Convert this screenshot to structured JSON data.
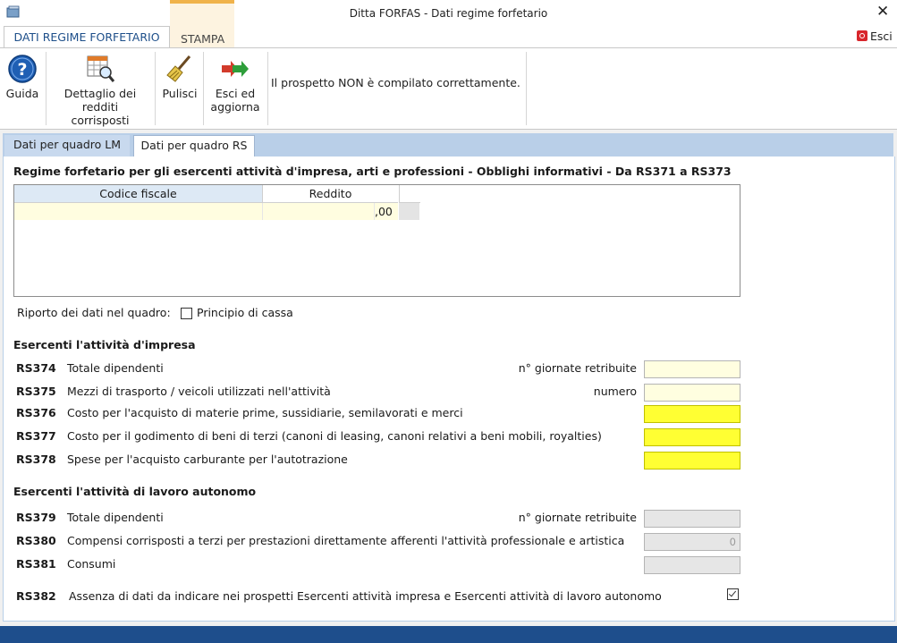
{
  "window": {
    "title": "Ditta FORFAS - Dati regime forfetario",
    "close_symbol": "✕"
  },
  "ribbon_tabs": [
    {
      "label": "DATI REGIME FORFETARIO",
      "active": true
    },
    {
      "label": "STAMPA",
      "active": false
    }
  ],
  "esci_top_label": "Esci",
  "toolbar": {
    "guida_label": "Guida",
    "dettaglio_line1": "Dettaglio dei",
    "dettaglio_line2": "redditi corrisposti",
    "pulisci_label": "Pulisci",
    "esci_line1": "Esci ed",
    "esci_line2": "aggiorna",
    "status_message": "Il prospetto NON è compilato correttamente."
  },
  "content_tabs": [
    {
      "label": "Dati per quadro LM",
      "active": false
    },
    {
      "label": "Dati per quadro RS",
      "active": true
    }
  ],
  "section_heading": "Regime forfetario per gli esercenti attività d'impresa, arti e professioni - Obblighi informativi - Da RS371 a RS373",
  "grid": {
    "headers": [
      "Codice fiscale",
      "Reddito"
    ],
    "rows": [
      {
        "codice_fiscale": "",
        "reddito": "",
        "decimals": ",00"
      }
    ]
  },
  "riporto": {
    "label": "Riporto dei dati nel quadro:",
    "checkbox_label": "Principio di cassa",
    "checked": false
  },
  "impresa": {
    "title": "Esercenti l'attività d'impresa",
    "rows": [
      {
        "code": "RS374",
        "desc": "Totale dipendenti",
        "right_label": "n° giornate retribuite",
        "field_color": "cream"
      },
      {
        "code": "RS375",
        "desc": "Mezzi di trasporto / veicoli utilizzati nell'attività",
        "right_label": "numero",
        "field_color": "cream"
      },
      {
        "code": "RS376",
        "desc": "Costo per l'acquisto di materie prime, sussidiarie, semilavorati e merci",
        "right_label": "",
        "field_color": "yellow"
      },
      {
        "code": "RS377",
        "desc": "Costo per il godimento di beni di terzi (canoni di leasing, canoni relativi a beni mobili, royalties)",
        "right_label": "",
        "field_color": "yellow"
      },
      {
        "code": "RS378",
        "desc": "Spese per l'acquisto carburante per l'autotrazione",
        "right_label": "",
        "field_color": "yellow"
      }
    ]
  },
  "autonomo": {
    "title": "Esercenti l'attività di lavoro autonomo",
    "rows": [
      {
        "code": "RS379",
        "desc": "Totale dipendenti",
        "right_label": "n° giornate retribuite",
        "value": ""
      },
      {
        "code": "RS380",
        "desc": "Compensi corrisposti a terzi per prestazioni direttamente afferenti l'attività professionale e artistica",
        "right_label": "",
        "value": "0"
      },
      {
        "code": "RS381",
        "desc": "Consumi",
        "right_label": "",
        "value": ""
      }
    ]
  },
  "rs382": {
    "code": "RS382",
    "desc": "Assenza di dati da indicare nei prospetti Esercenti attività impresa e Esercenti attività di lavoro autonomo",
    "checked": true
  }
}
